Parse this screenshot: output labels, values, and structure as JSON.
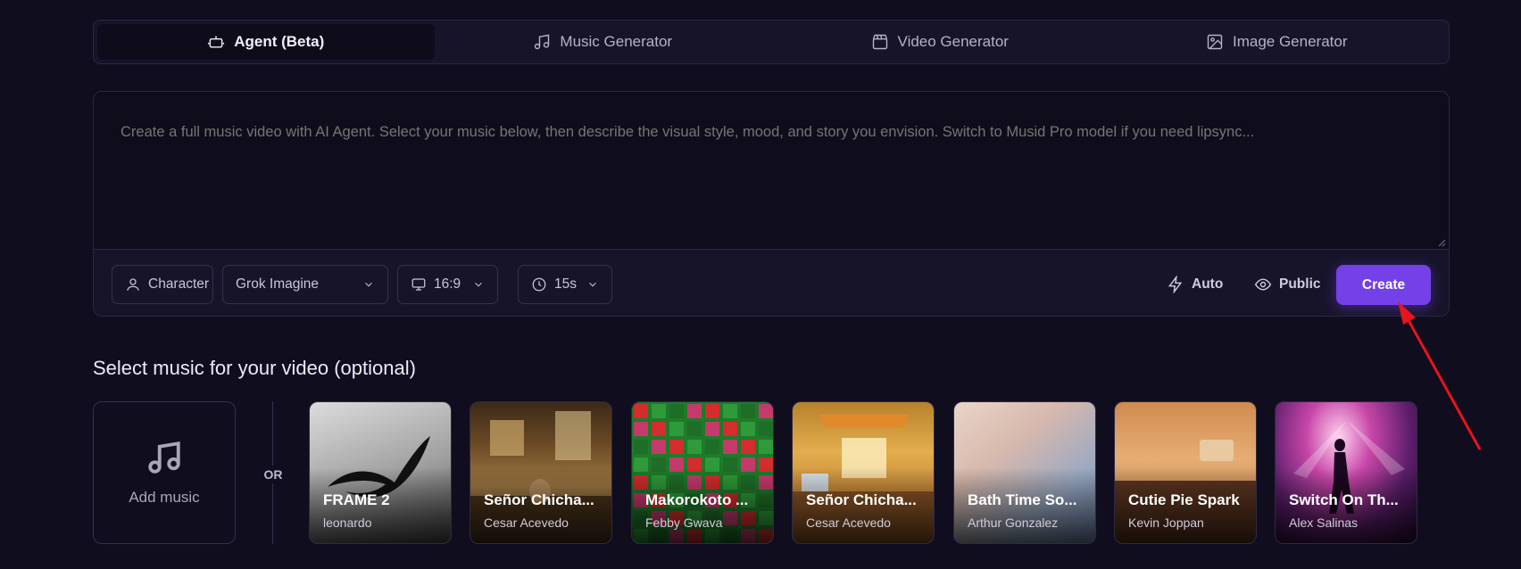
{
  "tabs": [
    {
      "label": "Agent (Beta)",
      "icon": "bot-icon",
      "active": true
    },
    {
      "label": "Music Generator",
      "icon": "music-note-icon",
      "active": false
    },
    {
      "label": "Video Generator",
      "icon": "clapperboard-icon",
      "active": false
    },
    {
      "label": "Image Generator",
      "icon": "image-icon",
      "active": false
    }
  ],
  "prompt": {
    "placeholder": "Create a full music video with AI Agent. Select your music below, then describe the visual style, mood, and story you envision. Switch to Musid Pro model if you need lipsync..."
  },
  "toolbar": {
    "character_label": "Character",
    "model_value": "Grok Imagine",
    "aspect_value": "16:9",
    "duration_value": "15s",
    "auto_label": "Auto",
    "public_label": "Public",
    "create_label": "Create"
  },
  "music": {
    "section_title": "Select music for your video (optional)",
    "add_label": "Add music",
    "or_label": "OR",
    "tracks": [
      {
        "title": "FRAME 2",
        "artist": "leonardo"
      },
      {
        "title": "Señor Chicha...",
        "artist": "Cesar Acevedo"
      },
      {
        "title": "Makorokoto ...",
        "artist": "Febby Gwava"
      },
      {
        "title": "Señor Chicha...",
        "artist": "Cesar Acevedo"
      },
      {
        "title": "Bath Time So...",
        "artist": "Arthur Gonzalez"
      },
      {
        "title": "Cutie Pie Spark",
        "artist": "Kevin Joppan"
      },
      {
        "title": "Switch On Th...",
        "artist": "Alex Salinas"
      }
    ]
  },
  "colors": {
    "background": "#100d1f",
    "accent": "#7440e8",
    "annotation_arrow": "#e8141c"
  }
}
